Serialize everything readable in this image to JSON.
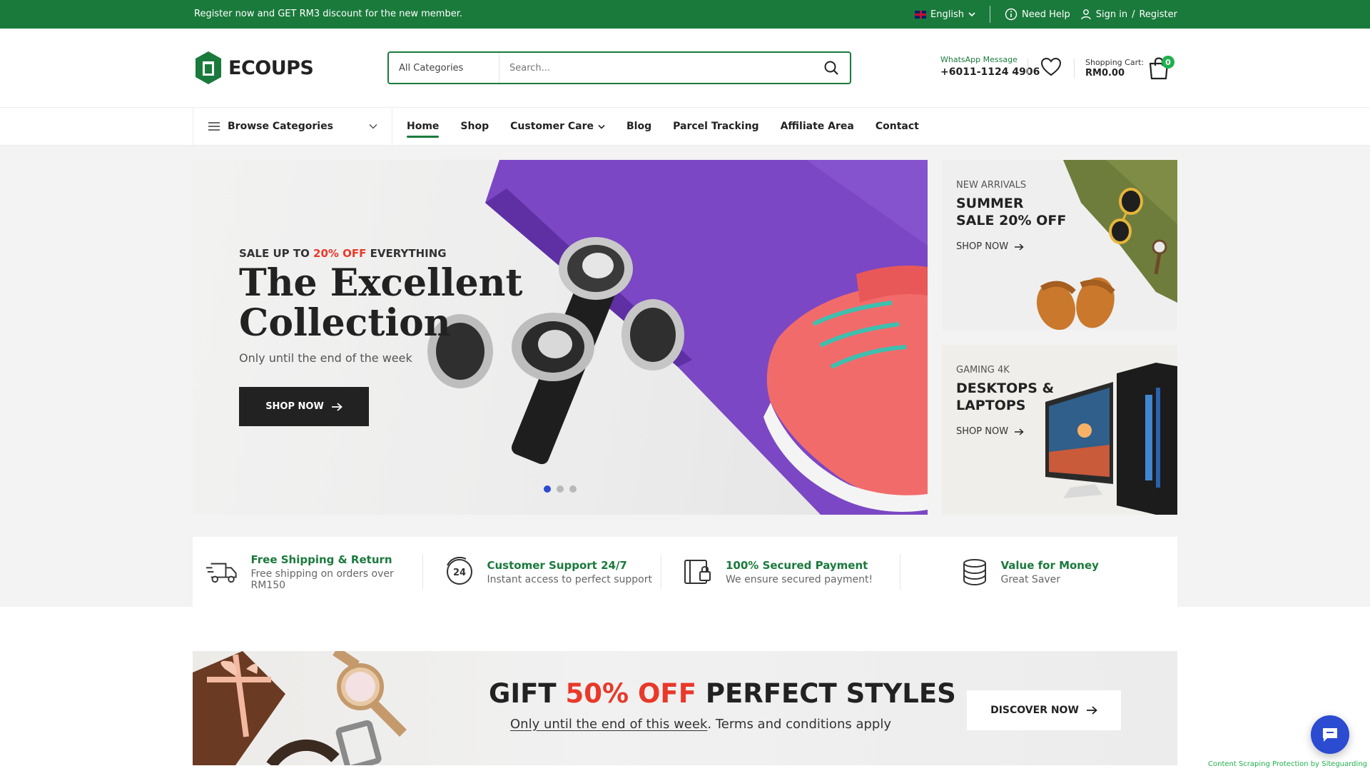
{
  "topbar": {
    "promo": "Register now and GET RM3 discount for the new member.",
    "language": "English",
    "need_help": "Need Help",
    "sign_in": "Sign in",
    "slash": "/",
    "register": "Register"
  },
  "brand": {
    "name": "ECOUPS",
    "color": "#1a7a3c"
  },
  "search": {
    "category": "All Categories",
    "placeholder": "Search..."
  },
  "contact": {
    "label": "WhatsApp Message",
    "number": "+6011-1124 4906"
  },
  "cart": {
    "label": "Shopping Cart:",
    "amount": "RM0.00",
    "count": "0"
  },
  "nav": {
    "browse": "Browse Categories",
    "links": [
      "Home",
      "Shop",
      "Customer Care",
      "Blog",
      "Parcel Tracking",
      "Affiliate Area",
      "Contact"
    ],
    "active": "Home"
  },
  "hero": {
    "kicker_pre": "SALE UP TO ",
    "kicker_highlight": "20% OFF",
    "kicker_post": " EVERYTHING",
    "title_line1": "The Excellent",
    "title_line2": "Collection",
    "subtitle": "Only until the end of the week",
    "cta": "SHOP NOW",
    "slides": 3,
    "active_slide": 1
  },
  "side_banners": [
    {
      "kicker": "NEW ARRIVALS",
      "title_line1": "SUMMER",
      "title_line2": "SALE 20% OFF",
      "cta": "SHOP NOW"
    },
    {
      "kicker": "GAMING 4K",
      "title_line1": "DESKTOPS &",
      "title_line2": "LAPTOPS",
      "cta": "SHOP NOW"
    }
  ],
  "features": [
    {
      "icon": "truck-icon",
      "title": "Free Shipping & Return",
      "desc": "Free shipping on orders over RM150"
    },
    {
      "icon": "support-24-icon",
      "title": "Customer Support 24/7",
      "desc": "Instant access to perfect support"
    },
    {
      "icon": "secure-payment-icon",
      "title": "100% Secured Payment",
      "desc": "We ensure secured payment!"
    },
    {
      "icon": "coins-icon",
      "title": "Value for Money",
      "desc": "Great Saver"
    }
  ],
  "gift": {
    "head_pre": "GIFT ",
    "head_highlight": "50% OFF",
    "head_post": " PERFECT STYLES",
    "sub_link": "Only until the end of this week",
    "sub_rest": ". Terms and conditions apply",
    "cta": "DISCOVER NOW"
  },
  "footer_note": "Content Scraping Protection by Siteguarding",
  "colors": {
    "accent": "#1a7a3c",
    "sale": "#e8392a",
    "dot_active": "#2b4bd1",
    "badge": "#1fb04c"
  }
}
